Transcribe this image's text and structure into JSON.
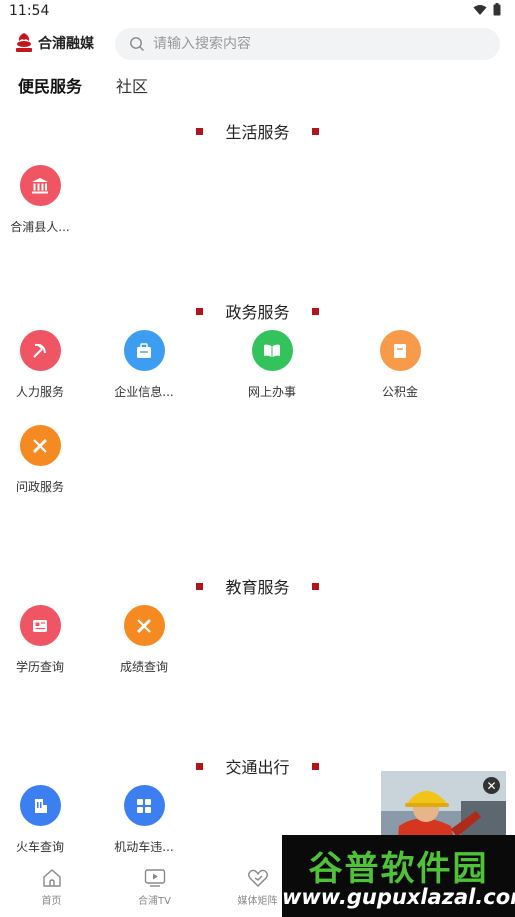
{
  "status": {
    "time": "11:54"
  },
  "header": {
    "logo_text": "合浦融媒",
    "search_placeholder": "请输入搜索内容"
  },
  "tabs": [
    {
      "label": "便民服务",
      "active": true
    },
    {
      "label": "社区",
      "active": false
    }
  ],
  "sections": [
    {
      "title": "生活服务",
      "items": [
        {
          "label": "合浦县人...",
          "icon": "government-building-icon",
          "color": "#f05563"
        }
      ]
    },
    {
      "title": "政务服务",
      "items": [
        {
          "label": "人力服务",
          "icon": "hammer-sickle-icon",
          "color": "#f05563"
        },
        {
          "label": "企业信息...",
          "icon": "briefcase-icon",
          "color": "#3c9df1"
        },
        {
          "label": "网上办事",
          "icon": "open-book-icon",
          "color": "#34c25d"
        },
        {
          "label": "公积金",
          "icon": "bookmark-card-icon",
          "color": "#f79a4a"
        },
        {
          "label": "问政服务",
          "icon": "pencil-cross-icon",
          "color": "#f58a22"
        }
      ]
    },
    {
      "title": "教育服务",
      "items": [
        {
          "label": "学历查询",
          "icon": "newspaper-icon",
          "color": "#f05563"
        },
        {
          "label": "成绩查询",
          "icon": "pencil-cross-icon",
          "color": "#f58a22"
        }
      ]
    },
    {
      "title": "交通出行",
      "items": [
        {
          "label": "火车查询",
          "icon": "building-icon",
          "color": "#3c7ff1"
        },
        {
          "label": "机动车违...",
          "icon": "grid-icon",
          "color": "#3c7ff1"
        }
      ]
    }
  ],
  "bottom_nav": [
    {
      "label": "首页",
      "icon": "home-icon"
    },
    {
      "label": "合浦TV",
      "icon": "tv-play-icon"
    },
    {
      "label": "媒体矩阵",
      "icon": "heart-hand-icon"
    },
    {
      "label": "",
      "icon": ""
    },
    {
      "label": "",
      "icon": ""
    }
  ],
  "float_ad": {
    "close_label": "✕"
  },
  "watermark": {
    "title": "谷普软件园",
    "url": "www.gupuxlazal.com"
  },
  "colors": {
    "accent_red": "#b3141b",
    "search_bg": "#f2f3f5"
  }
}
